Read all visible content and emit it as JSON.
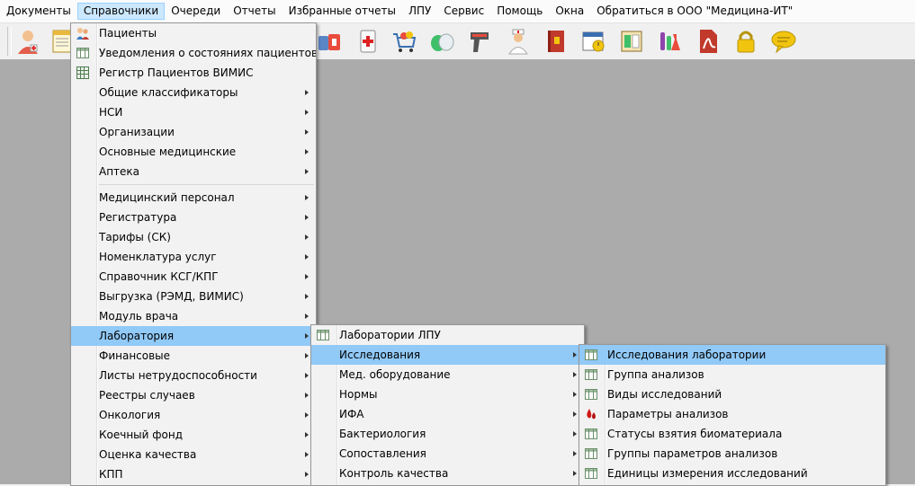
{
  "menubar": [
    {
      "label": "Документы",
      "active": false
    },
    {
      "label": "Справочники",
      "active": true
    },
    {
      "label": "Очереди",
      "active": false
    },
    {
      "label": "Отчеты",
      "active": false
    },
    {
      "label": "Избранные отчеты",
      "active": false
    },
    {
      "label": "ЛПУ",
      "active": false
    },
    {
      "label": "Сервис",
      "active": false
    },
    {
      "label": "Помощь",
      "active": false
    },
    {
      "label": "Окна",
      "active": false
    },
    {
      "label": "Обратиться в ООО \"Медицина-ИТ\"",
      "active": false
    }
  ],
  "toolbar_icons": [
    "doctor-icon",
    "document-icon",
    "medicines-icon",
    "first-aid-icon",
    "shopping-cart-icon",
    "pills-icon",
    "barcode-scanner-icon",
    "nurse-icon",
    "book-icon",
    "calendar-icon",
    "report-icon",
    "lab-flasks-icon",
    "pdf-icon",
    "lock-icon",
    "chat-icon"
  ],
  "menu_main": [
    {
      "label": "Пациенты",
      "icon": "patients-icon",
      "submenu": false
    },
    {
      "label": "Уведомления о состояниях пациентов",
      "icon": "table-icon",
      "submenu": false
    },
    {
      "label": "Регистр Пациентов ВИМИС",
      "icon": "grid-icon",
      "submenu": false
    },
    {
      "label": "Общие классификаторы",
      "submenu": true
    },
    {
      "label": "НСИ",
      "submenu": true
    },
    {
      "label": "Организации",
      "submenu": true
    },
    {
      "label": "Основные медицинские",
      "submenu": true
    },
    {
      "label": "Аптека",
      "submenu": true
    },
    {
      "separator": true
    },
    {
      "label": "Медицинский персонал",
      "submenu": true
    },
    {
      "label": "Регистратура",
      "submenu": true
    },
    {
      "label": "Тарифы (СК)",
      "submenu": true
    },
    {
      "label": "Номенклатура услуг",
      "submenu": true
    },
    {
      "label": "Справочник КСГ/КПГ",
      "submenu": true
    },
    {
      "label": "Выгрузка (РЭМД, ВИМИС)",
      "submenu": true
    },
    {
      "label": "Модуль врача",
      "submenu": true
    },
    {
      "label": "Лаборатория",
      "submenu": true,
      "selected": true
    },
    {
      "label": "Финансовые",
      "submenu": true
    },
    {
      "label": "Листы нетрудоспособности",
      "submenu": true
    },
    {
      "label": "Реестры случаев",
      "submenu": true
    },
    {
      "label": "Онкология",
      "submenu": true
    },
    {
      "label": "Коечный фонд",
      "submenu": true
    },
    {
      "label": "Оценка качества",
      "submenu": true
    },
    {
      "label": "КПП",
      "submenu": true
    }
  ],
  "menu_lab": [
    {
      "label": "Лаборатории ЛПУ",
      "icon": "table-icon",
      "submenu": false
    },
    {
      "label": "Исследования",
      "submenu": true,
      "selected": true
    },
    {
      "label": "Мед. оборудование",
      "submenu": true
    },
    {
      "label": "Нормы",
      "submenu": true
    },
    {
      "label": "ИФА",
      "submenu": true
    },
    {
      "label": "Бактериология",
      "submenu": true
    },
    {
      "label": "Сопоставления",
      "submenu": true
    },
    {
      "label": "Контроль качества",
      "submenu": true
    }
  ],
  "menu_research": [
    {
      "label": "Исследования лаборатории",
      "icon": "table-icon",
      "selected": true
    },
    {
      "label": "Группа анализов",
      "icon": "table-icon"
    },
    {
      "label": "Виды исследований",
      "icon": "table-icon"
    },
    {
      "label": "Параметры анализов",
      "icon": "blood-drop-icon"
    },
    {
      "label": "Статусы взятия биоматериала",
      "icon": "table-icon"
    },
    {
      "label": "Группы параметров анализов",
      "icon": "table-icon"
    },
    {
      "label": "Единицы измерения исследований",
      "icon": "table-icon"
    }
  ],
  "colors": {
    "menu_selected": "#91c9f7",
    "menubar_active": "#cce8ff",
    "workspace": "#ababab"
  }
}
